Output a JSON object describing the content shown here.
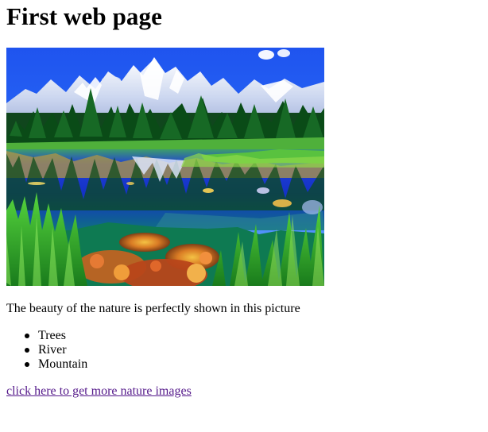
{
  "page": {
    "title": "First web page",
    "image": {
      "alt": "Mountain lake with trees",
      "colors": {
        "sky": "#2a62f4",
        "mountain": "#eef2fb",
        "trees": "#0f5a1d",
        "water": "#1737d8",
        "grass": "#52c92f",
        "rocks": "#c9621f"
      }
    },
    "caption": "The beauty of the nature is perfectly shown in this picture",
    "list_items": [
      "Trees",
      "River",
      "Mountain"
    ],
    "link": {
      "label": "click here to get more nature images",
      "color": "#551a8b"
    }
  }
}
